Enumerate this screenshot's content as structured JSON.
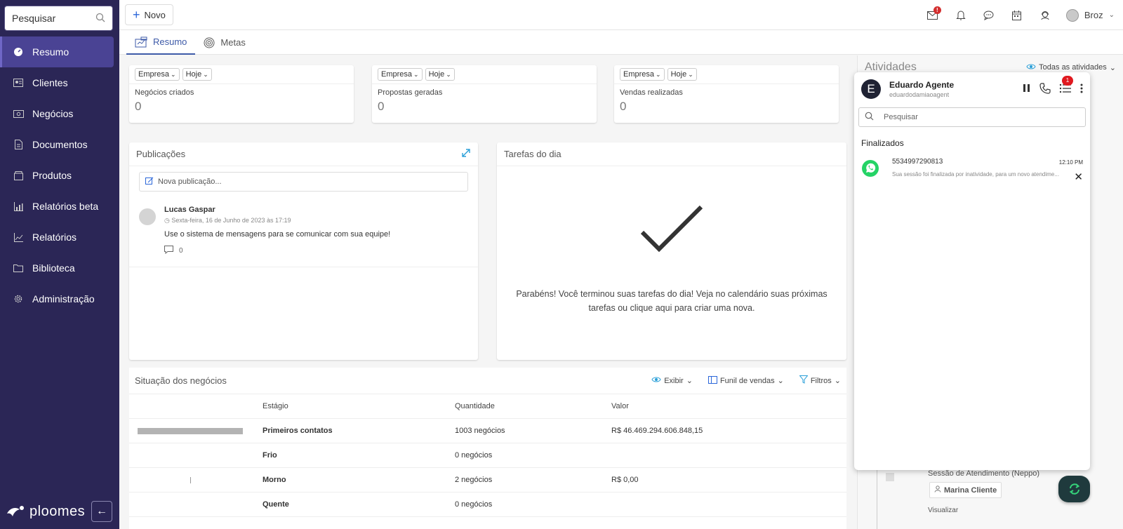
{
  "sidebar": {
    "search_label": "Pesquisar",
    "items": [
      {
        "label": "Resumo",
        "icon": "dashboard-icon"
      },
      {
        "label": "Clientes",
        "icon": "contacts-icon"
      },
      {
        "label": "Negócios",
        "icon": "money-icon"
      },
      {
        "label": "Documentos",
        "icon": "document-icon"
      },
      {
        "label": "Produtos",
        "icon": "box-icon"
      },
      {
        "label": "Relatórios beta",
        "icon": "bar-chart-icon"
      },
      {
        "label": "Relatórios",
        "icon": "line-chart-icon"
      },
      {
        "label": "Biblioteca",
        "icon": "folder-icon"
      },
      {
        "label": "Administração",
        "icon": "gear-icon"
      }
    ],
    "logo_text": "ploomes"
  },
  "topbar": {
    "new_label": "Novo",
    "mail_badge": "!",
    "user_name": "Broz"
  },
  "tabs": [
    {
      "label": "Resumo"
    },
    {
      "label": "Metas"
    }
  ],
  "kpis": [
    {
      "filter1": "Empresa",
      "filter2": "Hoje",
      "label": "Negócios criados",
      "value": "0"
    },
    {
      "filter1": "Empresa",
      "filter2": "Hoje",
      "label": "Propostas geradas",
      "value": "0"
    },
    {
      "filter1": "Empresa",
      "filter2": "Hoje",
      "label": "Vendas realizadas",
      "value": "0"
    }
  ],
  "publications": {
    "title": "Publicações",
    "input_placeholder": "Nova publicação...",
    "post": {
      "author": "Lucas Gaspar",
      "date": "Sexta-feira, 16 de Junho de 2023 às 17:19",
      "text": "Use o sistema de mensagens para se comunicar com sua equipe!",
      "comments": "0"
    }
  },
  "tasks": {
    "title": "Tarefas do dia",
    "message": "Parabéns! Você terminou suas tarefas do dia! Veja no calendário suas próximas tarefas ou clique aqui para criar uma nova."
  },
  "business": {
    "title": "Situação dos negócios",
    "actions": {
      "show": "Exibir",
      "funnel": "Funil de vendas",
      "filters": "Filtros"
    },
    "headers": {
      "stage": "Estágio",
      "quantity": "Quantidade",
      "value": "Valor"
    },
    "rows": [
      {
        "stage": "Primeiros contatos",
        "quantity": "1003 negócios",
        "value": "R$ 46.469.294.606.848,15",
        "bar": 1.0
      },
      {
        "stage": "Frio",
        "quantity": "0 negócios",
        "value": "",
        "bar": 0
      },
      {
        "stage": "Morno",
        "quantity": "2 negócios",
        "value": "R$ 0,00",
        "bar": 0.002
      },
      {
        "stage": "Quente",
        "quantity": "0 negócios",
        "value": "",
        "bar": 0
      }
    ]
  },
  "activity": {
    "title": "Atividades",
    "filter": "Todas as atividades",
    "session_text": "Sessão de Atendimento (Neppo)",
    "client": "Marina Cliente",
    "view": "Visualizar"
  },
  "widget": {
    "avatar_letter": "E",
    "agent_name": "Eduardo Agente",
    "agent_user": "eduardodamiaoagent",
    "badge": "1",
    "search_placeholder": "Pesquisar",
    "section": "Finalizados",
    "item": {
      "number": "5534997290813",
      "time": "12:10 PM",
      "message": "Sua sessão foi finalizada por inatividade, para um novo atendime..."
    }
  },
  "colors": {
    "sidebar_bg": "#2b2656",
    "accent": "#3d5aa8",
    "whatsapp": "#25d366",
    "fab_bg": "#1f3a3d"
  }
}
